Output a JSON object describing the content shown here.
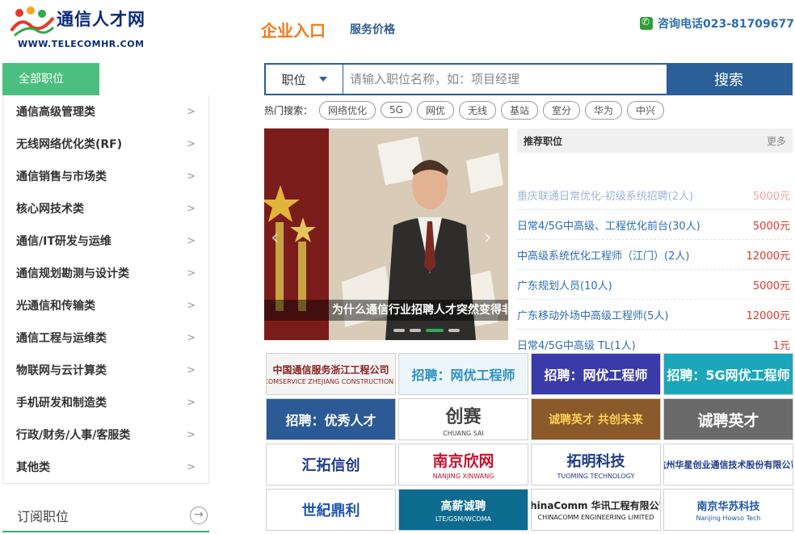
{
  "header": {
    "logo_name": "通信人才网",
    "logo_url": "WWW.TELECOMHR.COM",
    "nav_main": "企业入口",
    "nav_price": "服务价格",
    "phone": "咨询电话023-81709677"
  },
  "sidebar": {
    "header": "全部职位",
    "items": [
      {
        "label": "通信高级管理类"
      },
      {
        "label": "无线网络优化类(RF)"
      },
      {
        "label": "通信销售与市场类"
      },
      {
        "label": "核心网技术类"
      },
      {
        "label": "通信/IT研发与运维"
      },
      {
        "label": "通信规划勘测与设计类"
      },
      {
        "label": "光通信和传输类"
      },
      {
        "label": "通信工程与运维类"
      },
      {
        "label": "物联网与云计算类"
      },
      {
        "label": "手机研发和制造类"
      },
      {
        "label": "行政/财务/人事/客服类"
      },
      {
        "label": "其他类"
      }
    ],
    "arrow": ">",
    "subscribe": "订阅职位"
  },
  "search": {
    "select": "职位",
    "placeholder": "请输入职位名称，如：项目经理",
    "button": "搜索",
    "hot_label": "热门搜索：",
    "hot_tags": [
      "网络优化",
      "5G",
      "网优",
      "无线",
      "基站",
      "室分",
      "华为",
      "中兴"
    ]
  },
  "banner": {
    "caption": "为什么通信行业招聘人才突然变得非"
  },
  "recommend": {
    "title": "推荐职位",
    "more": "更多",
    "items": [
      {
        "title": "重庆联通日常优化-初级系统招聘(2人)",
        "salary": "5000元"
      },
      {
        "title": "日常4/5G中高级、工程优化前台(30人)",
        "salary": "5000元"
      },
      {
        "title": "中高级系统优化工程师（江门）(2人)",
        "salary": "12000元"
      },
      {
        "title": "广东规划人员(10人)",
        "salary": "5000元"
      },
      {
        "title": "广东移动外场中高级工程师(5人)",
        "salary": "12000元"
      },
      {
        "title": "日常4/5G中高级 TL(1人)",
        "salary": "1元"
      }
    ]
  },
  "logos": [
    {
      "text": "中国通信服务浙江工程公司",
      "sub": "CHINA COMSERVICE ZHEJIANG CONSTRUCTION CO.,LTD",
      "bg": "#f4f4f4",
      "fg": "#8a1f1f",
      "size": 12
    },
    {
      "text": "招聘：网优工程师",
      "sub": "",
      "bg": "#eef6fb",
      "fg": "#2a8fc6",
      "size": 16
    },
    {
      "text": "招聘：网优工程师",
      "sub": "",
      "bg": "#3a3aa8",
      "fg": "#ffffff",
      "size": 16
    },
    {
      "text": "招聘：5G网优工程师",
      "sub": "",
      "bg": "#1ba7b9",
      "fg": "#ffffff",
      "size": 16
    },
    {
      "text": "招聘：优秀人才",
      "sub": "",
      "bg": "#2b5a96",
      "fg": "#ffffff",
      "size": 16
    },
    {
      "text": "创赛",
      "sub": "CHUANG SAI",
      "bg": "#ffffff",
      "fg": "#444444",
      "size": 22
    },
    {
      "text": "诚聘英才 共创未来",
      "sub": "",
      "bg": "#8a5a2a",
      "fg": "#ffcf5a",
      "size": 14
    },
    {
      "text": "诚聘英才",
      "sub": "",
      "bg": "#6a6a6a",
      "fg": "#ffffff",
      "size": 19
    },
    {
      "text": "汇拓信创",
      "sub": "",
      "bg": "#ffffff",
      "fg": "#1f3b8c",
      "size": 18
    },
    {
      "text": "南京欣网",
      "sub": "NANJING XINWANG",
      "bg": "#ffffff",
      "fg": "#c8102e",
      "size": 19
    },
    {
      "text": "拓明科技",
      "sub": "TUOMING TECHNOLOGY",
      "bg": "#ffffff",
      "fg": "#1f3b8c",
      "size": 18
    },
    {
      "text": "杭州华星创业通信技术股份有限公司",
      "sub": "",
      "bg": "#ffffff",
      "fg": "#1f3b8c",
      "size": 11
    },
    {
      "text": "世紀鼎利",
      "sub": "",
      "bg": "#ffffff",
      "fg": "#1f56a8",
      "size": 18
    },
    {
      "text": "高薪诚聘",
      "sub": "LTE/GSM/WCDMA",
      "bg": "#0c6b8f",
      "fg": "#ffffff",
      "size": 14
    },
    {
      "text": "ChinaComm 华讯工程有限公司",
      "sub": "CHINACOMM ENGINEERING LIMITED",
      "bg": "#ffffff",
      "fg": "#222222",
      "size": 12
    },
    {
      "text": "南京华苏科技",
      "sub": "Nanjing Howso Tech",
      "bg": "#ffffff",
      "fg": "#1f56a8",
      "size": 13
    }
  ]
}
